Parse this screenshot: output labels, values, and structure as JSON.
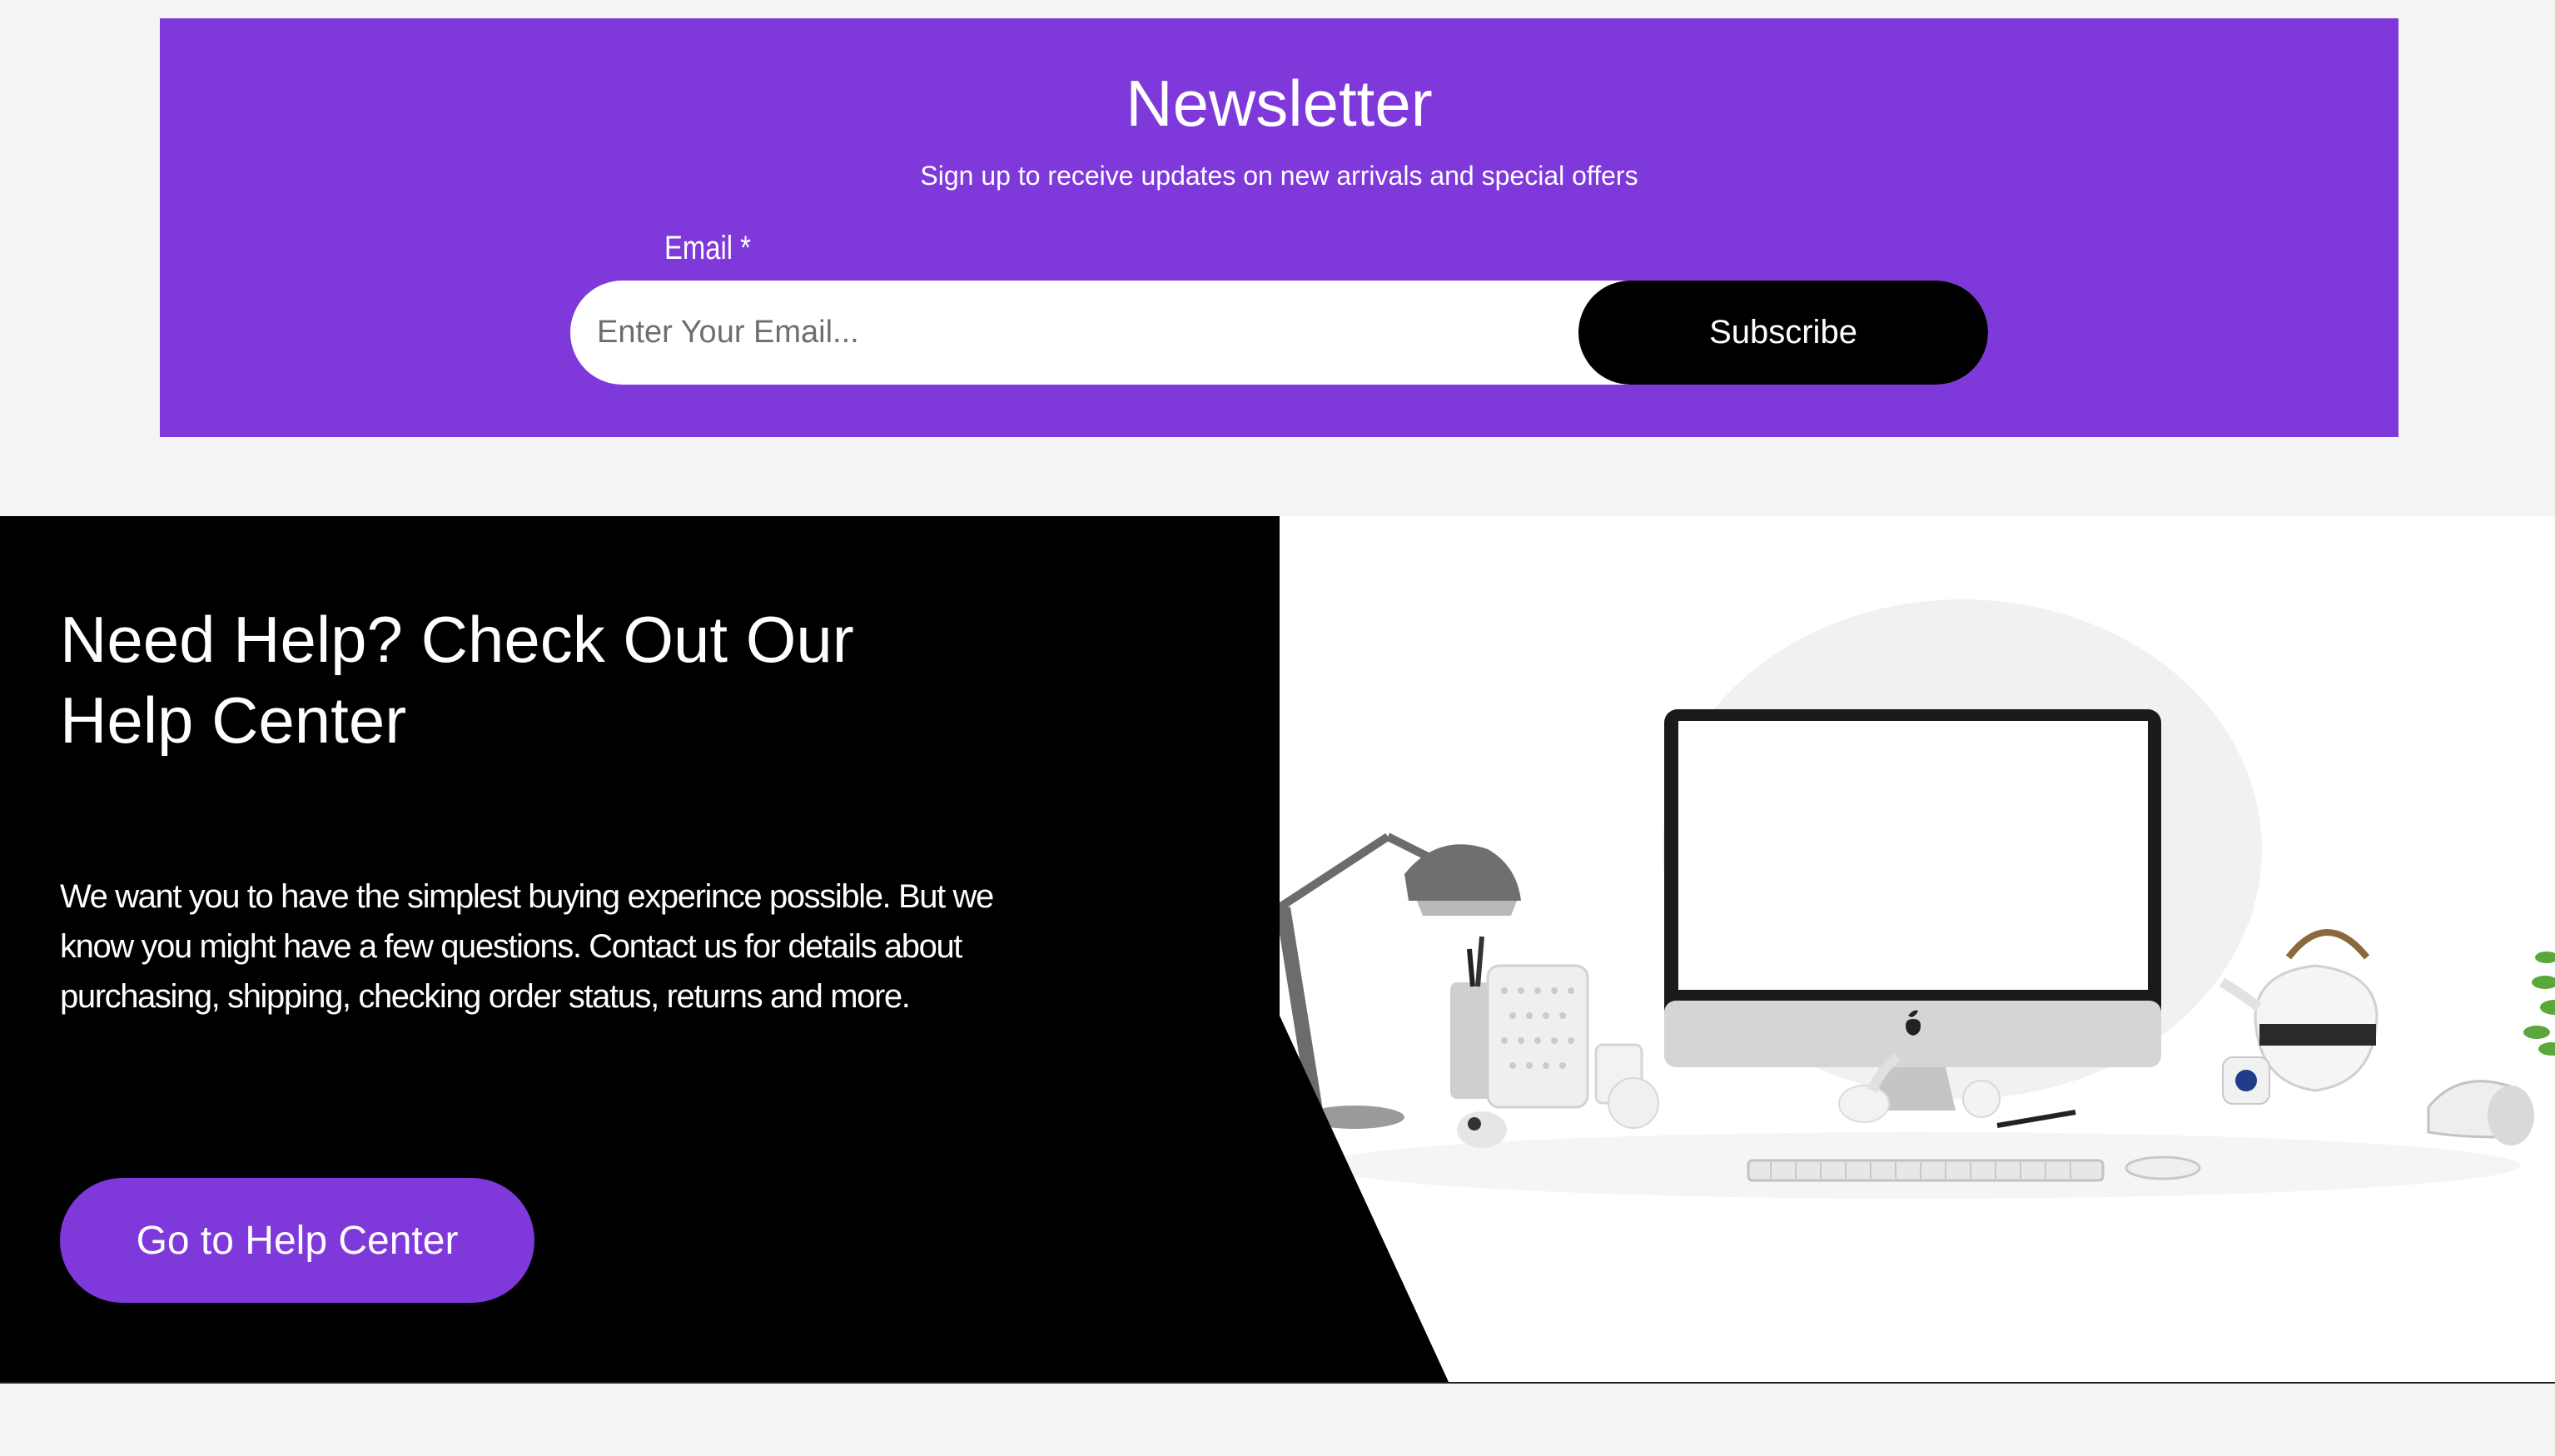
{
  "newsletter": {
    "title": "Newsletter",
    "subtitle": "Sign up to receive updates on new arrivals and special offers",
    "email_label": "Email *",
    "email_placeholder": "Enter Your Email...",
    "subscribe_label": "Subscribe",
    "background_color": "#7f39db"
  },
  "help": {
    "title": "Need Help? Check Out Our Help Center",
    "body": "We want you to have the simplest buying experince possible. But we know you might have a few questions. Contact us for details about purchasing, shipping, checking order status, returns and more.",
    "button_label": "Go to Help Center",
    "button_color": "#7f39db"
  }
}
